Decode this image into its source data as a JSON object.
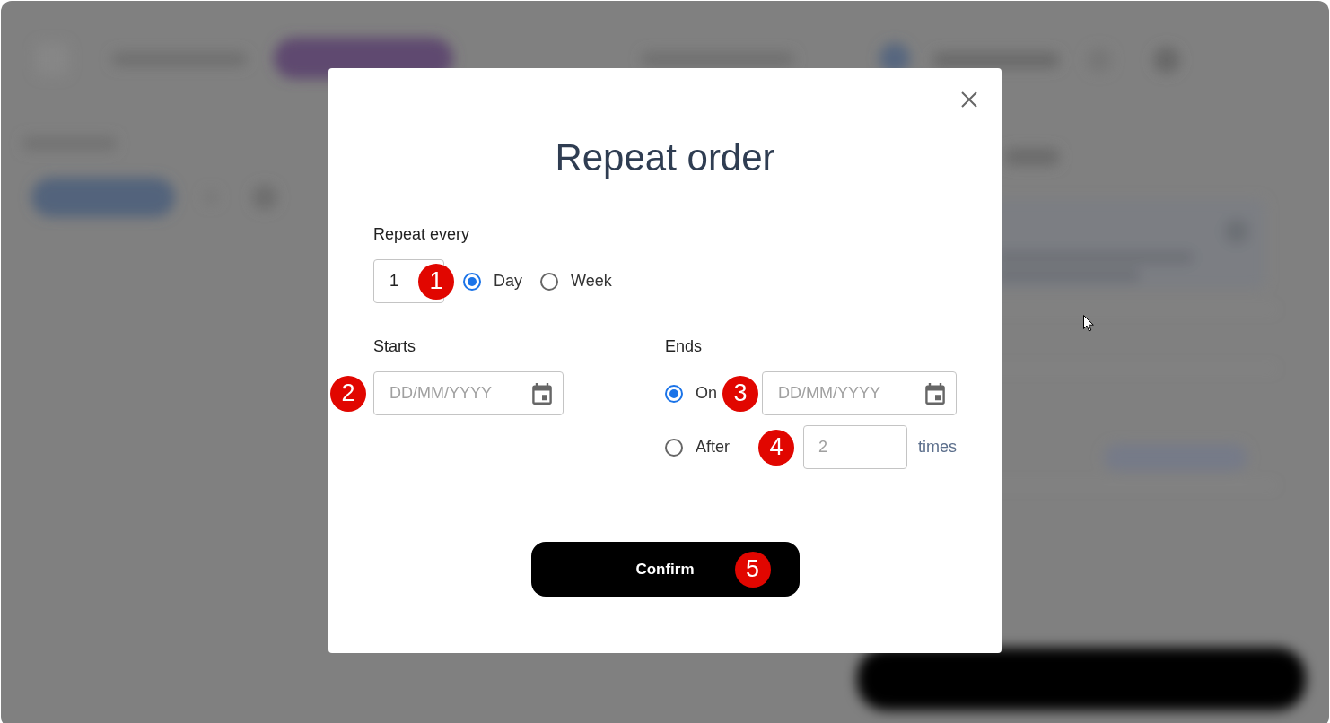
{
  "dialog": {
    "title": "Repeat order",
    "repeat_every": {
      "label": "Repeat every",
      "value": "1",
      "marker": "1",
      "units": [
        {
          "label": "Day",
          "selected": true
        },
        {
          "label": "Week",
          "selected": false
        }
      ]
    },
    "starts": {
      "label": "Starts",
      "placeholder": "DD/MM/YYYY",
      "marker": "2"
    },
    "ends": {
      "label": "Ends",
      "options": [
        {
          "kind": "date",
          "label": "On",
          "selected": true,
          "marker": "3",
          "placeholder": "DD/MM/YYYY"
        },
        {
          "kind": "count",
          "label": "After",
          "selected": false,
          "marker": "4",
          "placeholder": "2",
          "suffix": "times"
        }
      ]
    },
    "confirm": {
      "label": "Confirm",
      "marker": "5"
    }
  }
}
